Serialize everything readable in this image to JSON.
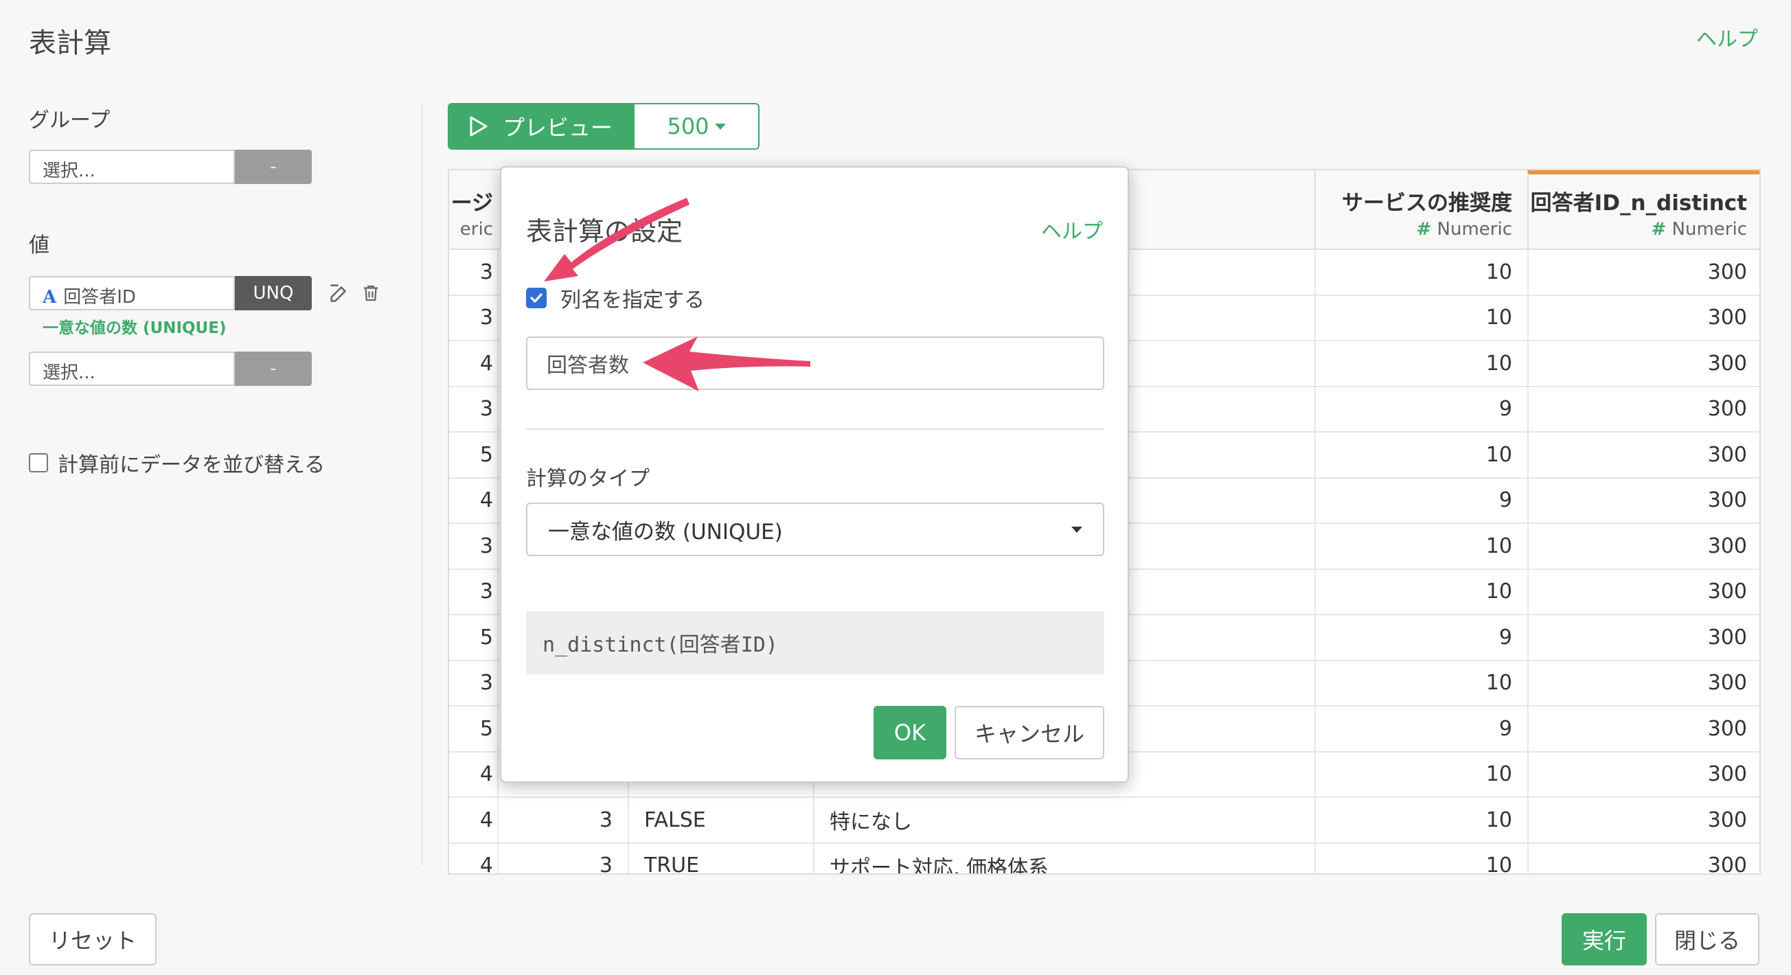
{
  "header": {
    "title": "表計算",
    "help": "ヘルプ"
  },
  "left": {
    "group_label": "グループ",
    "group_select_placeholder": "選択...",
    "group_select_btn": "-",
    "value_label": "値",
    "value_field": {
      "type_icon": "A",
      "name": "回答者ID",
      "agg": "UNQ",
      "note": "一意な値の数 (UNIQUE)"
    },
    "value_select_placeholder": "選択...",
    "value_select_btn": "-",
    "sort_label": "計算前にデータを並び替える"
  },
  "toolbar": {
    "preview_label": "プレビュー",
    "rows_value": "500"
  },
  "table": {
    "columns": [
      {
        "name": "ージ",
        "type": "eric"
      },
      {
        "name": "サービスの推奨度",
        "type": "Numeric",
        "hash": "#"
      },
      {
        "name": "回答者ID_n_distinct",
        "type": "Numeric",
        "hash": "#"
      }
    ],
    "rows": [
      [
        "3",
        "",
        "",
        "",
        "10",
        "300"
      ],
      [
        "3",
        "",
        "",
        "",
        "10",
        "300"
      ],
      [
        "4",
        "",
        "",
        "",
        "10",
        "300"
      ],
      [
        "3",
        "",
        "",
        "",
        "9",
        "300"
      ],
      [
        "5",
        "",
        "",
        "",
        "10",
        "300"
      ],
      [
        "4",
        "",
        "",
        "",
        "9",
        "300"
      ],
      [
        "3",
        "",
        "",
        "",
        "10",
        "300"
      ],
      [
        "3",
        "",
        "",
        "",
        "10",
        "300"
      ],
      [
        "5",
        "",
        "",
        "",
        "9",
        "300"
      ],
      [
        "3",
        "",
        "",
        "",
        "10",
        "300"
      ],
      [
        "5",
        "",
        "",
        "",
        "9",
        "300"
      ],
      [
        "4",
        "",
        "",
        "",
        "10",
        "300"
      ],
      [
        "4",
        "3",
        "FALSE",
        "特になし",
        "10",
        "300"
      ],
      [
        "4",
        "3",
        "TRUE",
        "サポート対応, 価格体系",
        "10",
        "300"
      ]
    ]
  },
  "modal": {
    "title": "表計算の設定",
    "help": "ヘルプ",
    "specify_col_label": "列名を指定する",
    "specify_col_checked": true,
    "col_name_value": "回答者数",
    "calc_type_label": "計算のタイプ",
    "calc_type_value": "一意な値の数 (UNIQUE)",
    "expression": "n_distinct(回答者ID)",
    "ok_label": "OK",
    "cancel_label": "キャンセル"
  },
  "footer": {
    "reset_label": "リセット",
    "run_label": "実行",
    "close_label": "閉じる"
  },
  "colors": {
    "accent": "#3faa6a",
    "checkbox": "#2f6fd6",
    "arrow": "#e8456b",
    "highlight": "#e8953e"
  }
}
